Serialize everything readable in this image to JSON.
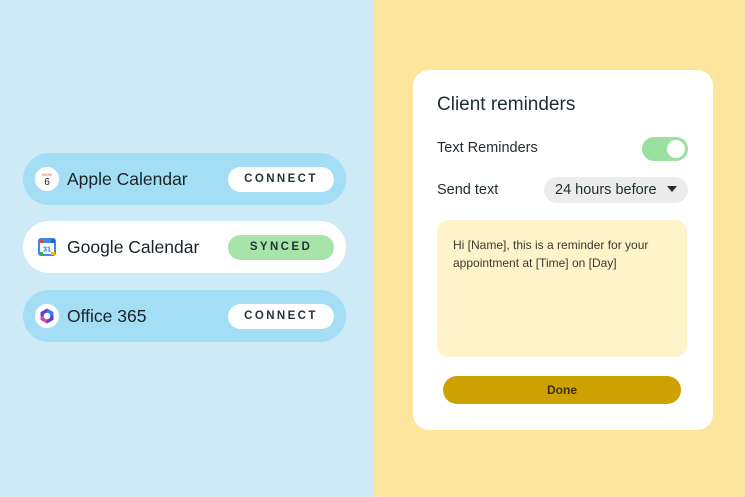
{
  "integrations": [
    {
      "name": "Apple Calendar",
      "action": "CONNECT",
      "icon": "apple-calendar-icon",
      "icon_month": "MON",
      "icon_day": "6"
    },
    {
      "name": "Google Calendar",
      "action": "SYNCED",
      "icon": "google-calendar-icon",
      "icon_day": "31"
    },
    {
      "name": "Office 365",
      "action": "CONNECT",
      "icon": "office-365-icon"
    }
  ],
  "reminders": {
    "title": "Client reminders",
    "text_reminders_label": "Text Reminders",
    "text_reminders_enabled": true,
    "send_text_label": "Send text",
    "send_text_value": "24 hours before",
    "message": "Hi [Name], this is a reminder for your appointment at [Time] on [Day]",
    "done_label": "Done"
  },
  "colors": {
    "left_background": "#cdeaf6",
    "right_background": "#fee59e",
    "pill_blue": "#a3def4",
    "synced_green": "#a6e4a9",
    "toggle_on": "#9ae09f",
    "done_button": "#cda100",
    "message_background": "#fff3c9"
  }
}
